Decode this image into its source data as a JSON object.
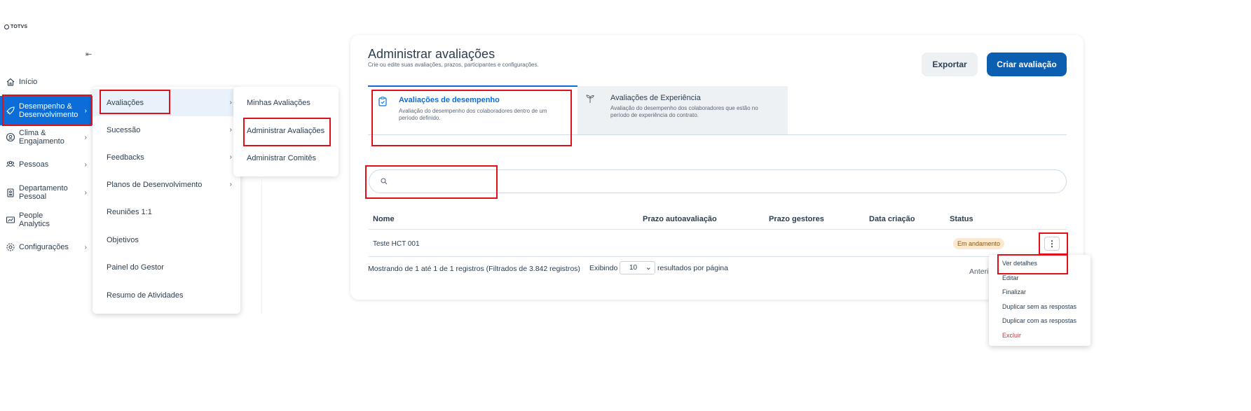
{
  "app": {
    "logo_text": "TOTVS"
  },
  "sidebar": {
    "items": [
      {
        "label_l1": "Início",
        "label_l2": ""
      },
      {
        "label_l1": "Desempenho &",
        "label_l2": "Desenvolvimento"
      },
      {
        "label_l1": "Clima &",
        "label_l2": "Engajamento"
      },
      {
        "label_l1": "Pessoas",
        "label_l2": ""
      },
      {
        "label_l1": "Departamento",
        "label_l2": "Pessoal"
      },
      {
        "label_l1": "People",
        "label_l2": "Analytics"
      },
      {
        "label_l1": "Configurações",
        "label_l2": ""
      }
    ]
  },
  "submenu": {
    "items": [
      "Avaliações",
      "Sucessão",
      "Feedbacks",
      "Planos de Desenvolvimento",
      "Reuniões 1:1",
      "Objetivos",
      "Painel do Gestor",
      "Resumo de Atividades"
    ]
  },
  "submenu2": {
    "items": [
      "Minhas Avaliações",
      "Administrar Avaliações",
      "Administrar Comitês"
    ]
  },
  "page": {
    "title": "Administrar avaliações",
    "subtitle": "Crie ou edite suas avaliações, prazos, participantes e configurações.",
    "export_label": "Exportar",
    "create_label": "Criar avaliação"
  },
  "tabs": [
    {
      "title": "Avaliações de desempenho",
      "desc_l1": "Avaliação do desempenho dos colaboradores dentro de um",
      "desc_l2": "período definido."
    },
    {
      "title": "Avaliações de Experiência",
      "desc_l1": "Avaliação do desempenho dos colaboradores que estão no",
      "desc_l2": "período de experiência do contrato."
    }
  ],
  "table": {
    "headers": [
      "Nome",
      "Prazo autoavaliação",
      "Prazo gestores",
      "Data criação",
      "Status"
    ],
    "rows": [
      {
        "name": "Teste HCT 001",
        "status": "Em andamento"
      }
    ],
    "footer_info": "Mostrando de 1 até 1 de 1 registros (Filtrados de 3.842 registros)",
    "showing_label": "Exibindo",
    "page_size": "10",
    "per_page_label": "resultados por página",
    "prev_label": "Anteri"
  },
  "row_menu": {
    "items": [
      "Ver detalhes",
      "Editar",
      "Finalizar",
      "Duplicar sem as respostas",
      "Duplicar com as respostas",
      "Excluir"
    ]
  },
  "colors": {
    "primary": "#0c6dd8",
    "button_primary": "#0c5fb0",
    "danger": "#d32f2f",
    "highlight": "#e0101a"
  }
}
